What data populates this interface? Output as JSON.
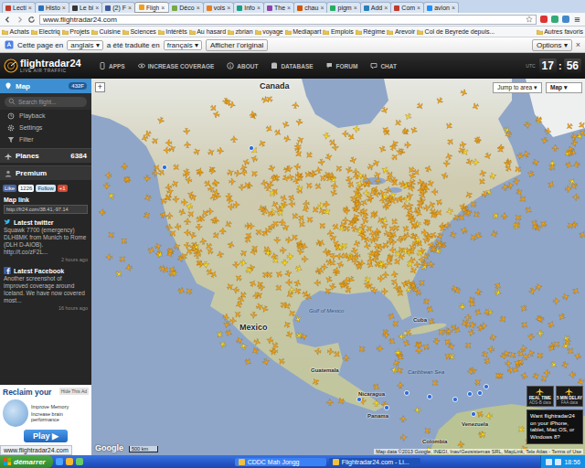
{
  "browser": {
    "tabs": [
      {
        "label": "Lecti",
        "selected": false
      },
      {
        "label": "Histo",
        "selected": false
      },
      {
        "label": "Le bi",
        "selected": false
      },
      {
        "label": "(2) F",
        "selected": false
      },
      {
        "label": "Fligh",
        "selected": true
      },
      {
        "label": "Déco",
        "selected": false
      },
      {
        "label": "vols",
        "selected": false
      },
      {
        "label": "Info",
        "selected": false
      },
      {
        "label": "The",
        "selected": false
      },
      {
        "label": "chau",
        "selected": false
      },
      {
        "label": "pigm",
        "selected": false
      },
      {
        "label": "Add",
        "selected": false
      },
      {
        "label": "Com",
        "selected": false
      },
      {
        "label": "avion",
        "selected": false
      }
    ],
    "tab_close": "×",
    "address": "www.flightradar24.com",
    "bookmarks": [
      "Achats",
      "Electriq",
      "Projets",
      "Cuisine",
      "Sciences",
      "Intérêts",
      "Au hasard",
      "zbrian",
      "voyage",
      "Mediapart",
      "Emplois",
      "Régime",
      "Arevoir",
      "Col de Beyrede depuis..."
    ],
    "other_bookmarks": "Autres favoris",
    "status_url": "www.flightradar24.com"
  },
  "translate_bar": {
    "prefix": "Cette page en",
    "from": "anglais",
    "middle": "a été traduite en",
    "to": "français",
    "show_original": "Afficher l'original",
    "options": "Options",
    "dropdown_mark": "▾",
    "close": "×"
  },
  "header": {
    "logo": "flightradar24",
    "tagline": "LIVE AIR TRAFFIC",
    "nav": [
      "APPS",
      "INCREASE COVERAGE",
      "ABOUT",
      "DATABASE",
      "FORUM",
      "CHAT"
    ],
    "utc": "UTC",
    "clock": {
      "hours": "17",
      "sep": ":",
      "minutes": "56"
    }
  },
  "sidebar": {
    "map_item": {
      "label": "Map",
      "badge": "432F",
      "selected": true
    },
    "search_placeholder": "Search flight...",
    "tools": [
      "Playback",
      "Settings",
      "Filter"
    ],
    "planes": {
      "label": "Planes",
      "count": "6384"
    },
    "premium": "Premium",
    "social": {
      "like": "Like",
      "like_count": "1226",
      "follow": "Follow",
      "plus": "+1"
    },
    "map_link": {
      "label": "Map link",
      "url": "http://fr24.com/38.41,-97.14"
    },
    "twitter": {
      "title": "Latest twitter",
      "text": "Squawk 7700 (emergency) DLH8MK from Munich to Rome (DLH D-AIOB). http://t.co/zF2L...",
      "age": "2 hours ago"
    },
    "facebook": {
      "title": "Latest Facebook",
      "text": "Another screenshot of improved coverage around Iceland. We have now covered most...",
      "age": "16 hours ago"
    },
    "ad": {
      "title": "Reclaim your",
      "hide": "Hide This Ad",
      "bullets": [
        "Improve Memory",
        "Increase brain performance"
      ],
      "play": "Play",
      "play_icon": "▶"
    }
  },
  "map": {
    "zoom_in": "+",
    "jump": "Jump to area",
    "type": "Map",
    "labels": [
      {
        "text": "Canada",
        "kind": "country"
      },
      {
        "text": "Gulf of Mexico",
        "kind": "water"
      },
      {
        "text": "Mexico",
        "kind": "country"
      },
      {
        "text": "Cuba",
        "kind": "country"
      },
      {
        "text": "Guatemala",
        "kind": "country"
      },
      {
        "text": "Caribbean Sea",
        "kind": "water"
      },
      {
        "text": "Nicaragua",
        "kind": "country"
      },
      {
        "text": "Panama",
        "kind": "country"
      },
      {
        "text": "Venezuela",
        "kind": "country"
      },
      {
        "text": "Colombia",
        "kind": "country"
      }
    ],
    "scale": "500 km",
    "google": "Google",
    "attribution": "Map data ©2013 Google, INEGI, Inav/Geosistemas SRL, MapLink, Tele Atlas - Terms of Use",
    "badges": [
      {
        "top": "REAL TIME",
        "bottom": "ADS-B data"
      },
      {
        "top": "5 MIN DELAY",
        "bottom": "FAA data"
      }
    ],
    "promo": "Want flightradar24 on your iPhone, tablet, Mac OS, or Windows 8?"
  },
  "taskbar": {
    "start": "démarrer",
    "tasks": [
      {
        "label": "CDDC Mah Jongg",
        "selected": false
      },
      {
        "label": "Flightradar24.com - Li...",
        "selected": true
      }
    ],
    "clock": "18:56"
  }
}
